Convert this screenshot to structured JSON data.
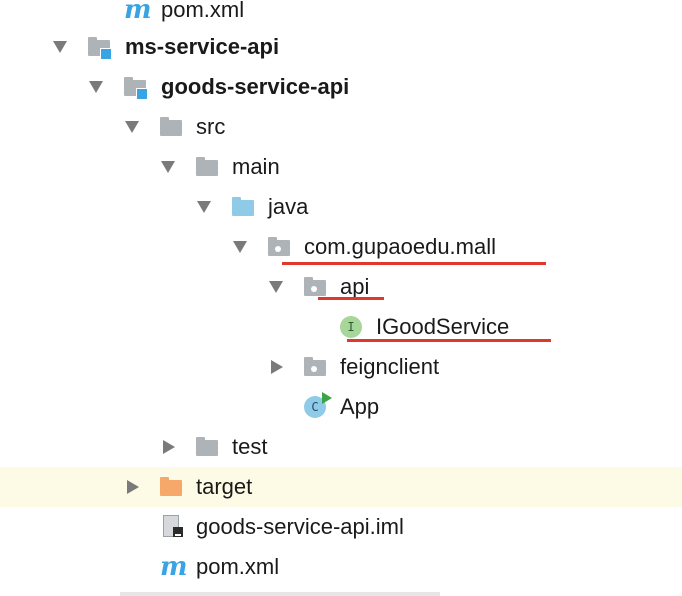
{
  "tree": {
    "rows": [
      {
        "label": "pom.xml",
        "icon": "maven-icon"
      },
      {
        "label": "ms-service-api",
        "icon": "module-folder-icon"
      },
      {
        "label": "goods-service-api",
        "icon": "module-folder-icon"
      },
      {
        "label": "src",
        "icon": "folder-icon"
      },
      {
        "label": "main",
        "icon": "folder-icon"
      },
      {
        "label": "java",
        "icon": "source-folder-icon"
      },
      {
        "label": "com.gupaoedu.mall",
        "icon": "package-icon"
      },
      {
        "label": "api",
        "icon": "package-icon"
      },
      {
        "label": "IGoodService",
        "icon": "interface-icon",
        "badge": "I"
      },
      {
        "label": "feignclient",
        "icon": "package-icon"
      },
      {
        "label": "App",
        "icon": "class-icon",
        "badge": "C"
      },
      {
        "label": "test",
        "icon": "folder-icon"
      },
      {
        "label": "target",
        "icon": "excluded-folder-icon"
      },
      {
        "label": "goods-service-api.iml",
        "icon": "iml-file-icon"
      },
      {
        "label": "pom.xml",
        "icon": "maven-icon"
      }
    ]
  },
  "colors": {
    "folder": "#aeb3b8",
    "source_folder": "#8fcbe6",
    "excluded_folder": "#f5a86a",
    "module_badge": "#3aa3e3",
    "interface_icon": "#a7d69a",
    "class_icon": "#8fcbe6",
    "underline": "#e0392b",
    "highlight_row": "#fdfbe6"
  }
}
